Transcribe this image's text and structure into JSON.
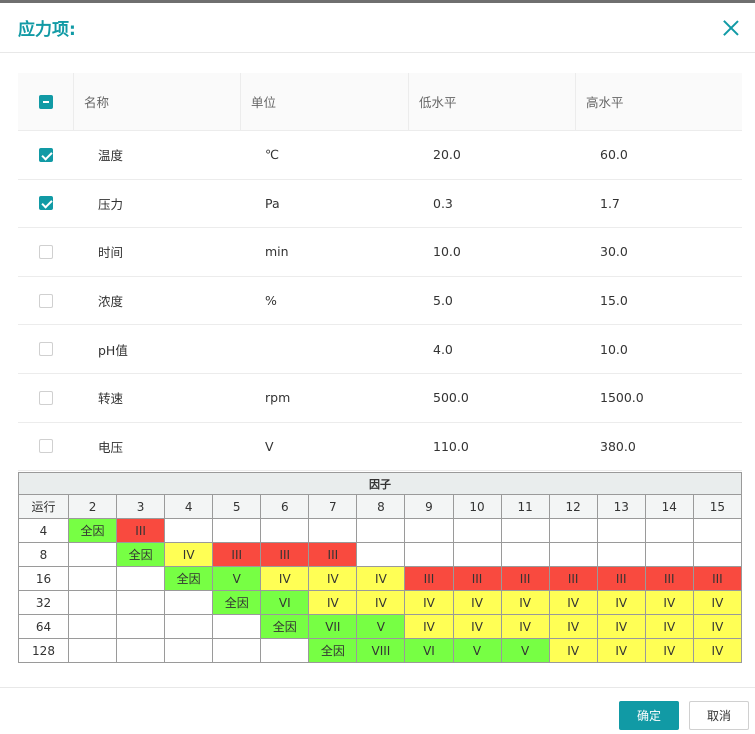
{
  "dialog": {
    "title": "应力项:"
  },
  "stress_table": {
    "headers": {
      "name": "名称",
      "unit": "单位",
      "low": "低水平",
      "high": "高水平"
    },
    "rows": [
      {
        "name": "温度",
        "unit": "℃",
        "low": "20.0",
        "high": "60.0",
        "checked": true
      },
      {
        "name": "压力",
        "unit": "Pa",
        "low": "0.3",
        "high": "1.7",
        "checked": true
      },
      {
        "name": "时间",
        "unit": "min",
        "low": "10.0",
        "high": "30.0",
        "checked": false
      },
      {
        "name": "浓度",
        "unit": "%",
        "low": "5.0",
        "high": "15.0",
        "checked": false
      },
      {
        "name": "pH值",
        "unit": "",
        "low": "4.0",
        "high": "10.0",
        "checked": false
      },
      {
        "name": "转速",
        "unit": "rpm",
        "low": "500.0",
        "high": "1500.0",
        "checked": false
      },
      {
        "name": "电压",
        "unit": "V",
        "low": "110.0",
        "high": "380.0",
        "checked": false
      }
    ]
  },
  "factor_table": {
    "caption": "因子",
    "run_label": "运行",
    "factors": [
      "2",
      "3",
      "4",
      "5",
      "6",
      "7",
      "8",
      "9",
      "10",
      "11",
      "12",
      "13",
      "14",
      "15"
    ],
    "rows": [
      {
        "runs": "4",
        "cells": [
          "全因",
          "III",
          "",
          "",
          "",
          "",
          "",
          "",
          "",
          "",
          "",
          "",
          "",
          ""
        ]
      },
      {
        "runs": "8",
        "cells": [
          "",
          "全因",
          "IV",
          "III",
          "III",
          "III",
          "",
          "",
          "",
          "",
          "",
          "",
          "",
          ""
        ]
      },
      {
        "runs": "16",
        "cells": [
          "",
          "",
          "全因",
          "V",
          "IV",
          "IV",
          "IV",
          "III",
          "III",
          "III",
          "III",
          "III",
          "III",
          "III"
        ]
      },
      {
        "runs": "32",
        "cells": [
          "",
          "",
          "",
          "全因",
          "VI",
          "IV",
          "IV",
          "IV",
          "IV",
          "IV",
          "IV",
          "IV",
          "IV",
          "IV"
        ]
      },
      {
        "runs": "64",
        "cells": [
          "",
          "",
          "",
          "",
          "全因",
          "VII",
          "V",
          "IV",
          "IV",
          "IV",
          "IV",
          "IV",
          "IV",
          "IV"
        ]
      },
      {
        "runs": "128",
        "cells": [
          "",
          "",
          "",
          "",
          "",
          "全因",
          "VIII",
          "VI",
          "V",
          "V",
          "IV",
          "IV",
          "IV",
          "IV"
        ]
      }
    ],
    "colors": {
      "full": "#77ff44",
      "green": "#77ff44",
      "yellow": "#ffff55",
      "red": "#f94a3f"
    }
  },
  "footer": {
    "ok_label": "确定",
    "cancel_label": "取消"
  }
}
